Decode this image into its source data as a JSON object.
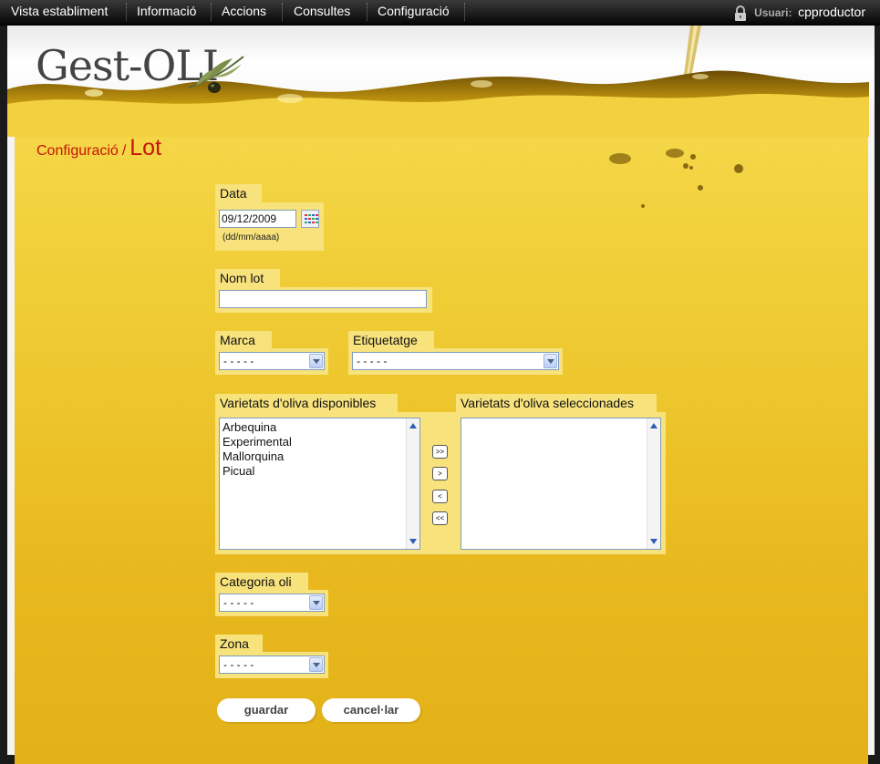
{
  "nav": {
    "items": [
      "Vista establiment",
      "Informació",
      "Accions",
      "Consultes",
      "Configuració"
    ]
  },
  "user": {
    "label": "Usuari:",
    "name": "cpproductor"
  },
  "logo": {
    "text": "Gest-OLI"
  },
  "breadcrumb": {
    "parent": "Configuració",
    "separator": "/",
    "current": "Lot"
  },
  "form": {
    "date": {
      "label": "Data",
      "value": "09/12/2009",
      "hint": "(dd/mm/aaaa)"
    },
    "lot_name": {
      "label": "Nom lot",
      "value": ""
    },
    "brand": {
      "label": "Marca",
      "selected": "- - - - -"
    },
    "labeling": {
      "label": "Etiquetatge",
      "selected": "- - - - -"
    },
    "available_varieties": {
      "label": "Varietats d'oliva disponibles",
      "options": [
        "Arbequina",
        "Experimental",
        "Mallorquina",
        "Picual"
      ]
    },
    "selected_varieties": {
      "label": "Varietats d'oliva seleccionades",
      "options": []
    },
    "move_buttons": {
      "all_right": ">>",
      "right": ">",
      "left": "<",
      "all_left": "<<"
    },
    "oil_category": {
      "label": "Categoria oli",
      "selected": "- - - - -"
    },
    "zone": {
      "label": "Zona",
      "selected": "- - - - -"
    },
    "save_label": "guardar",
    "cancel_label": "cancel·lar"
  },
  "colors": {
    "accent": "#c8140a",
    "oil": "#f0cc35",
    "label_bg": "#f7e27c"
  }
}
